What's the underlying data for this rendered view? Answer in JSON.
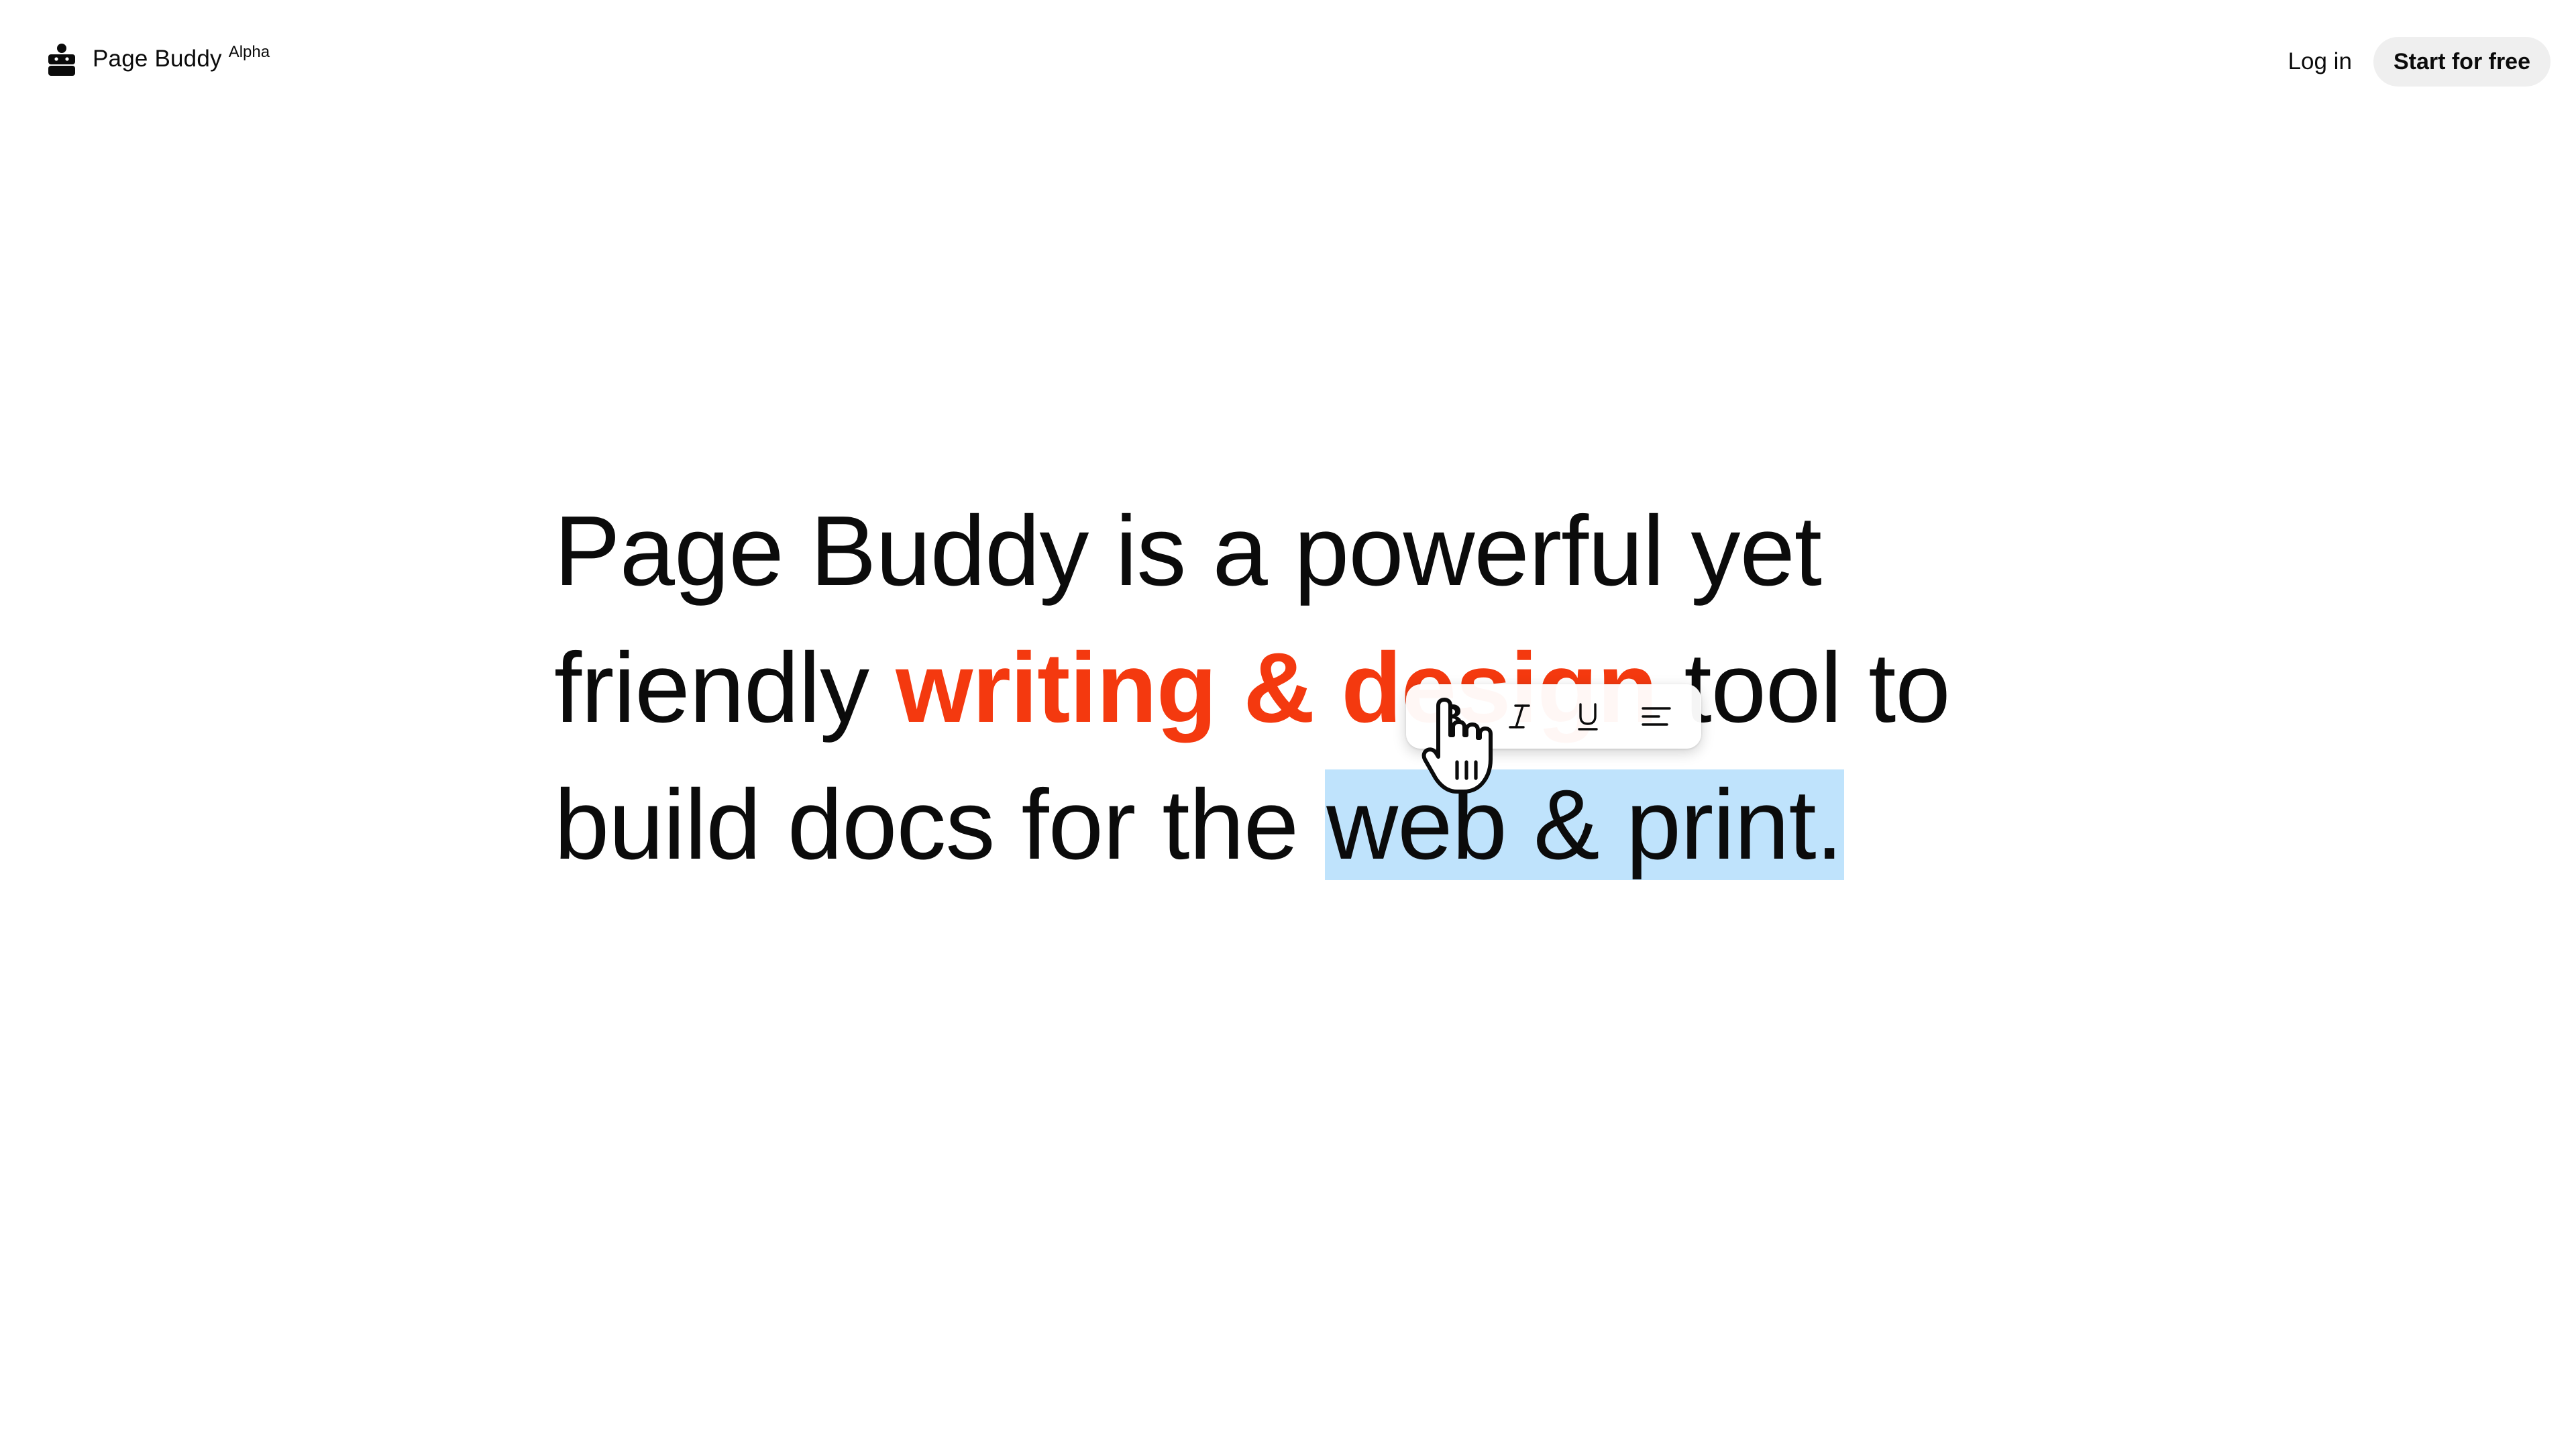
{
  "header": {
    "brand_name": "Page Buddy",
    "brand_badge": "Alpha",
    "login_label": "Log in",
    "start_label": "Start for free"
  },
  "hero": {
    "line1": "Page Buddy is a powerful yet",
    "line2_start": "friendly ",
    "line2_accent": "writing & design",
    "line2_end": " tool to",
    "line3_start": "build docs for the ",
    "line3_selected": "web & print."
  },
  "toolbar": {
    "items": [
      {
        "icon": "bold-icon"
      },
      {
        "icon": "italic-icon"
      },
      {
        "icon": "underline-icon"
      },
      {
        "icon": "align-left-icon"
      }
    ]
  },
  "colors": {
    "accent": "#f4390f",
    "selection": "#bfe3fc",
    "button_bg": "#efefef",
    "text": "#0b0b0b"
  },
  "cursor": {
    "icon": "hand-pointer-icon"
  }
}
